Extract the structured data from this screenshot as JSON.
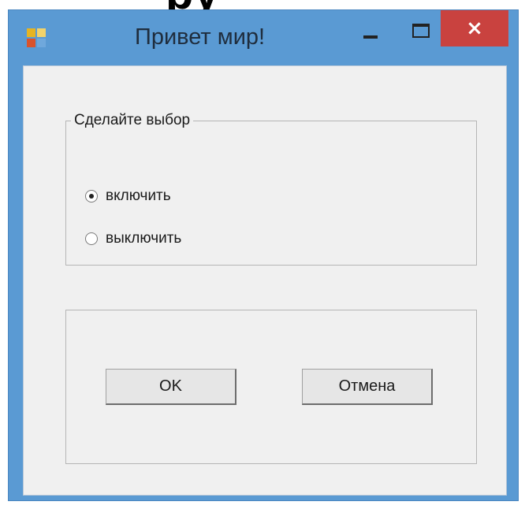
{
  "window": {
    "title": "Привет мир!",
    "close_glyph": "×"
  },
  "group_choice": {
    "title": "Сделайте выбор",
    "options": [
      {
        "label": "включить",
        "checked": true
      },
      {
        "label": "выключить",
        "checked": false
      }
    ]
  },
  "buttons": {
    "ok_label": "OK",
    "cancel_label": "Отмена"
  },
  "colors": {
    "titlebar": "#5a9ad3",
    "close_button": "#c9423f",
    "client_background": "#f0f0f0"
  }
}
